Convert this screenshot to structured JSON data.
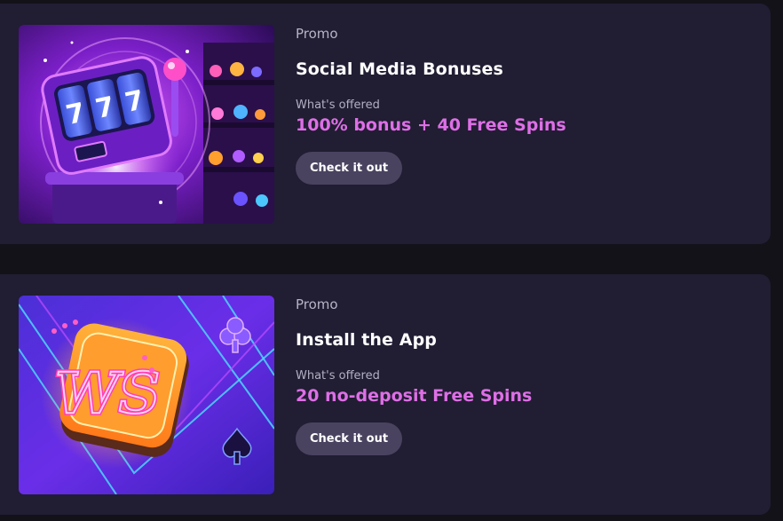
{
  "promos": [
    {
      "tag": "Promo",
      "title": "Social Media Bonuses",
      "offer_label": "What's offered",
      "offer_value": "100% bonus + 40 Free Spins",
      "button_label": "Check it out",
      "image": "slot-machine-illustration"
    },
    {
      "tag": "Promo",
      "title": "Install the App",
      "offer_label": "What's offered",
      "offer_value": "20 no-deposit Free Spins",
      "button_label": "Check it out",
      "image": "ws-neon-logo-illustration"
    }
  ],
  "colors": {
    "page_bg": "#131219",
    "card_bg": "#211d33",
    "offer_accent": "#de6fe6",
    "button_bg": "#4a4360"
  }
}
